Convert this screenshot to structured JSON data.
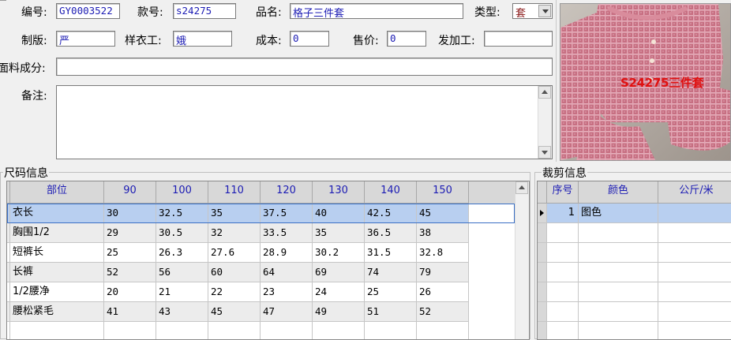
{
  "form": {
    "no_label": "编号:",
    "no_value": "GY0003522",
    "style_label": "款号:",
    "style_value": "s24275",
    "name_label": "品名:",
    "name_value": "格子三件套",
    "type_label": "类型:",
    "type_value": "套",
    "plate_label": "制版:",
    "plate_value": "严",
    "sample_label": "样衣工:",
    "sample_value": "娥",
    "cost_label": "成本:",
    "cost_value": "0",
    "price_label": "售价:",
    "price_value": "0",
    "process_label": "发加工:",
    "process_value": "",
    "fabric_label": "面料成分:",
    "fabric_value": "",
    "remark_label": "备注:",
    "remark_value": ""
  },
  "photo": {
    "caption": "S24275三件套"
  },
  "size_panel": {
    "title": "尺码信息",
    "headers": [
      "部位",
      "90",
      "100",
      "110",
      "120",
      "130",
      "140",
      "150"
    ],
    "rows": [
      [
        "衣长",
        "30",
        "32.5",
        "35",
        "37.5",
        "40",
        "42.5",
        "45"
      ],
      [
        "胸围1/2",
        "29",
        "30.5",
        "32",
        "33.5",
        "35",
        "36.5",
        "38"
      ],
      [
        "短裤长",
        "25",
        "26.3",
        "27.6",
        "28.9",
        "30.2",
        "31.5",
        "32.8"
      ],
      [
        "长裤",
        "52",
        "56",
        "60",
        "64",
        "69",
        "74",
        "79"
      ],
      [
        "1/2腰净",
        "20",
        "21",
        "22",
        "23",
        "24",
        "25",
        "26"
      ],
      [
        "腰松紧毛",
        "41",
        "43",
        "45",
        "47",
        "49",
        "51",
        "52"
      ]
    ]
  },
  "cut_panel": {
    "title": "裁剪信息",
    "headers": [
      "序号",
      "颜色",
      "公斤/米"
    ],
    "rows": [
      [
        "1",
        "图色",
        ""
      ]
    ]
  }
}
